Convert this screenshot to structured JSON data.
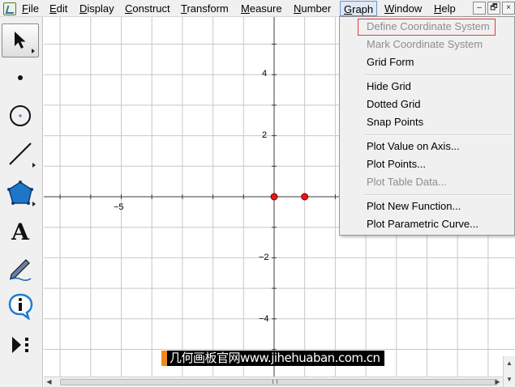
{
  "menubar": {
    "items": [
      {
        "pre": "",
        "ul": "F",
        "post": "ile"
      },
      {
        "pre": "",
        "ul": "E",
        "post": "dit"
      },
      {
        "pre": "",
        "ul": "D",
        "post": "isplay"
      },
      {
        "pre": "",
        "ul": "C",
        "post": "onstruct"
      },
      {
        "pre": "",
        "ul": "T",
        "post": "ransform"
      },
      {
        "pre": "",
        "ul": "M",
        "post": "easure"
      },
      {
        "pre": "",
        "ul": "N",
        "post": "umber"
      },
      {
        "pre": "",
        "ul": "G",
        "post": "raph"
      },
      {
        "pre": "",
        "ul": "W",
        "post": "indow"
      },
      {
        "pre": "",
        "ul": "H",
        "post": "elp"
      }
    ],
    "window_buttons": {
      "minimize": "–",
      "restore": "🗗",
      "close": "×"
    }
  },
  "toolbox": {
    "tools": [
      {
        "name": "arrow-tool",
        "icon": "arrow-select-icon",
        "selected": true
      },
      {
        "name": "point-tool",
        "icon": "point-icon"
      },
      {
        "name": "compass-tool",
        "icon": "circle-icon"
      },
      {
        "name": "straightedge-tool",
        "icon": "segment-icon"
      },
      {
        "name": "polygon-tool",
        "icon": "polygon-icon"
      },
      {
        "name": "text-tool",
        "icon": "text-A-icon",
        "label": "A"
      },
      {
        "name": "marker-tool",
        "icon": "pen-icon"
      },
      {
        "name": "information-tool",
        "icon": "info-icon",
        "label": "i"
      },
      {
        "name": "custom-tool",
        "icon": "custom-tool-icon"
      }
    ]
  },
  "canvas": {
    "x_labels": [
      "−5"
    ],
    "y_labels": [
      "4",
      "2",
      "−2",
      "−4"
    ],
    "points": [
      {
        "x": 0,
        "y": 0,
        "color": "#e8161b"
      },
      {
        "x": 1,
        "y": 0,
        "color": "#e8161b"
      }
    ],
    "grid_color": "#c8c8c8",
    "axis_color": "#3c3c3c"
  },
  "graph_menu": {
    "items": [
      {
        "label": "Define Coordinate System",
        "disabled": true,
        "highlighted": true
      },
      {
        "label": "Mark Coordinate System",
        "disabled": true
      },
      {
        "label": "Grid Form",
        "disabled": false
      },
      {
        "label": "Hide Grid",
        "disabled": false
      },
      {
        "label": "Dotted Grid",
        "disabled": false
      },
      {
        "label": "Snap Points",
        "disabled": false
      },
      {
        "label": "Plot Value on Axis...",
        "disabled": false
      },
      {
        "label": "Plot Points...",
        "disabled": false
      },
      {
        "label": "Plot Table Data...",
        "disabled": true
      },
      {
        "label": "Plot New Function...",
        "disabled": false
      },
      {
        "label": "Plot Parametric Curve...",
        "disabled": false
      }
    ],
    "highlight_color": "#e23a3a"
  },
  "watermark": {
    "text": "几何画板官网www.jihehuaban.com.cn"
  }
}
